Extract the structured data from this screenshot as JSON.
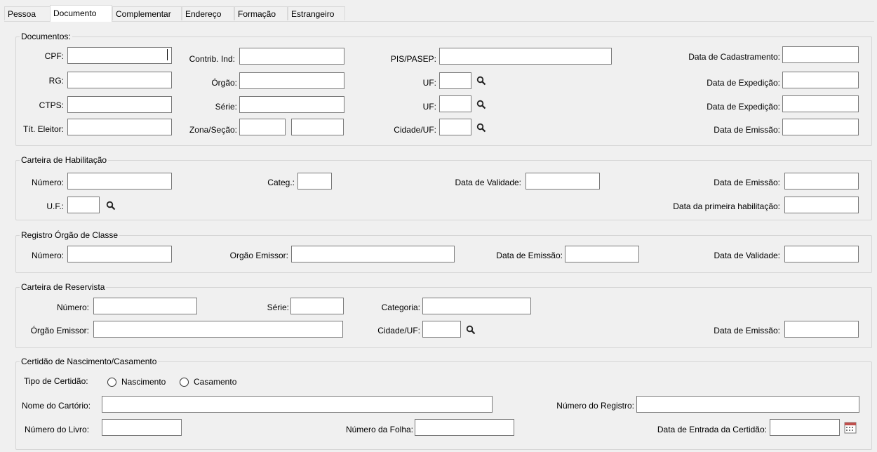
{
  "tabs": [
    "Pessoa",
    "Documento",
    "Complementar",
    "Endereço",
    "Formação",
    "Estrangeiro"
  ],
  "documentos": {
    "title": "Documentos:",
    "cpf": "CPF:",
    "contrib_ind": "Contrib. Ind:",
    "pis_pasep": "PIS/PASEP:",
    "data_cadastramento": "Data de Cadastramento:",
    "rg": "RG:",
    "orgao": "Órgão:",
    "uf": "UF:",
    "data_expedicao": "Data de Expedição:",
    "ctps": "CTPS:",
    "serie": "Série:",
    "uf2": "UF:",
    "data_expedicao2": "Data de Expedição:",
    "tit_eleitor": "Tít. Eleitor:",
    "zona_secao": "Zona/Seção:",
    "cidade_uf": "Cidade/UF:",
    "data_emissao": "Data de Emissão:"
  },
  "habilitacao": {
    "title": "Carteira de Habilitação",
    "numero": "Número:",
    "categ": "Categ.:",
    "data_validade": "Data de Validade:",
    "data_emissao": "Data de Emissão:",
    "uf": "U.F.:",
    "primeira_hab": "Data da primeira habilitação:"
  },
  "orgao_classe": {
    "title": "Registro Órgão de Classe",
    "numero": "Número:",
    "orgao_emissor": "Orgão Emissor:",
    "data_emissao": "Data de Emissão:",
    "data_validade": "Data de Validade:"
  },
  "reservista": {
    "title": "Carteira de Reservista",
    "numero": "Número:",
    "serie": "Série:",
    "categoria": "Categoria:",
    "orgao_emissor": "Órgão Emissor:",
    "cidade_uf": "Cidade/UF:",
    "data_emissao": "Data de Emissão:"
  },
  "certidao": {
    "title": "Certidão de Nascimento/Casamento",
    "tipo": "Tipo de Certidão:",
    "nascimento": "Nascimento",
    "casamento": "Casamento",
    "nome_cartorio": "Nome do Cartório:",
    "numero_registro": "Número do Registro:",
    "numero_livro": "Número do Livro:",
    "numero_folha": "Número da Folha:",
    "data_entrada": "Data de Entrada da Certidão:"
  },
  "icons": {
    "lookup": "magnifier-icon",
    "calendar": "calendar-icon"
  }
}
